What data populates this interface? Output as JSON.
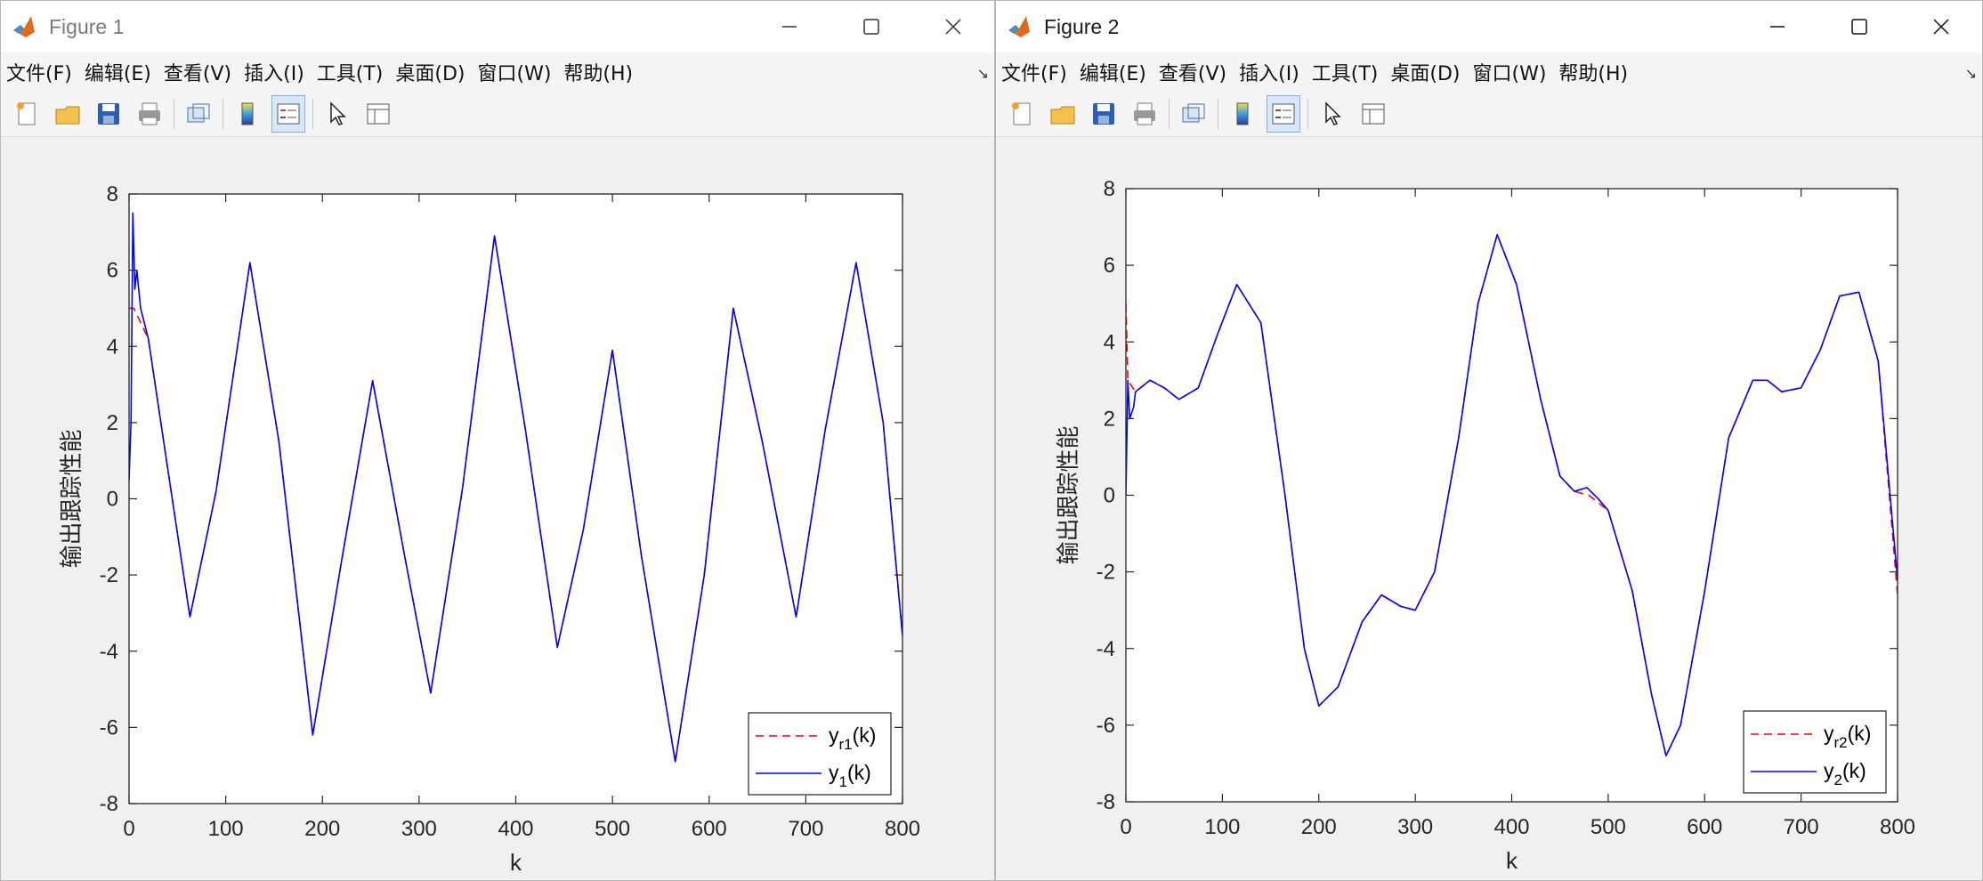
{
  "windows": [
    {
      "title": "Figure 1",
      "menus": [
        "文件(F)",
        "编辑(E)",
        "查看(V)",
        "插入(I)",
        "工具(T)",
        "桌面(D)",
        "窗口(W)",
        "帮助(H)"
      ],
      "toolbar_icons": [
        "new-figure-icon",
        "open-file-icon",
        "save-icon",
        "print-icon",
        "link-icon",
        "colorbar-icon",
        "legend-icon",
        "pointer-icon",
        "property-editor-icon"
      ]
    },
    {
      "title": "Figure 2",
      "menus": [
        "文件(F)",
        "编辑(E)",
        "查看(V)",
        "插入(I)",
        "工具(T)",
        "桌面(D)",
        "窗口(W)",
        "帮助(H)"
      ],
      "toolbar_icons": [
        "new-figure-icon",
        "open-file-icon",
        "save-icon",
        "print-icon",
        "link-icon",
        "colorbar-icon",
        "legend-icon",
        "pointer-icon",
        "property-editor-icon"
      ]
    }
  ],
  "colors": {
    "reference": "#ff0000",
    "output": "#0000ff",
    "axes_bg": "#ffffff",
    "frame_bg": "#f0f0f0"
  },
  "chart_data": [
    {
      "type": "line",
      "xlabel": "k",
      "ylabel": "输出跟踪性能",
      "xlim": [
        0,
        800
      ],
      "ylim": [
        -8,
        8
      ],
      "xticks": [
        "0",
        "100",
        "200",
        "300",
        "400",
        "500",
        "600",
        "700",
        "800"
      ],
      "yticks": [
        "-8",
        "-6",
        "-4",
        "-2",
        "0",
        "2",
        "4",
        "6",
        "8"
      ],
      "legend_position": "bottom-right",
      "grid": false,
      "legend": {
        "ref_sub": "r1",
        "out_sub": "1"
      },
      "series": [
        {
          "name": "y_r1(k)",
          "style": "dashed",
          "color": "#ff0000",
          "x": [
            0,
            5,
            20,
            40,
            63,
            90,
            125,
            155,
            190,
            220,
            252,
            285,
            312,
            345,
            378,
            410,
            443,
            470,
            500,
            530,
            565,
            595,
            625,
            655,
            690,
            720,
            752,
            780,
            800
          ],
          "y": [
            5.0,
            5.0,
            4.2,
            0.8,
            -3.1,
            0.2,
            6.2,
            1.5,
            -6.2,
            -1.6,
            3.1,
            -1.5,
            -5.1,
            0.3,
            6.9,
            1.8,
            -3.9,
            -0.8,
            3.9,
            -1.5,
            -6.9,
            -2.0,
            5.0,
            1.5,
            -3.1,
            1.8,
            6.2,
            2.0,
            -3.6
          ]
        },
        {
          "name": "y_1(k)",
          "style": "solid",
          "color": "#0000ff",
          "x": [
            0,
            2,
            4,
            6,
            8,
            12,
            20,
            40,
            63,
            90,
            125,
            155,
            190,
            220,
            252,
            285,
            312,
            345,
            378,
            410,
            443,
            470,
            500,
            530,
            565,
            595,
            625,
            655,
            690,
            720,
            752,
            780,
            800
          ],
          "y": [
            0.5,
            2.0,
            7.5,
            5.5,
            6.0,
            5.0,
            4.2,
            0.8,
            -3.1,
            0.2,
            6.2,
            1.5,
            -6.2,
            -1.6,
            3.1,
            -1.5,
            -5.1,
            0.3,
            6.9,
            1.8,
            -3.9,
            -0.8,
            3.9,
            -1.5,
            -6.9,
            -2.0,
            5.0,
            1.5,
            -3.1,
            1.8,
            6.2,
            2.0,
            -3.6
          ]
        }
      ]
    },
    {
      "type": "line",
      "xlabel": "k",
      "ylabel": "输出跟踪性能",
      "xlim": [
        0,
        800
      ],
      "ylim": [
        -8,
        8
      ],
      "xticks": [
        "0",
        "100",
        "200",
        "300",
        "400",
        "500",
        "600",
        "700",
        "800"
      ],
      "yticks": [
        "-8",
        "-6",
        "-4",
        "-2",
        "0",
        "2",
        "4",
        "6",
        "8"
      ],
      "legend_position": "bottom-right",
      "grid": false,
      "legend": {
        "ref_sub": "r2",
        "out_sub": "2"
      },
      "series": [
        {
          "name": "y_r2(k)",
          "style": "dashed",
          "color": "#ff0000",
          "x": [
            0,
            2,
            10,
            25,
            40,
            55,
            75,
            95,
            115,
            140,
            165,
            185,
            200,
            220,
            245,
            265,
            285,
            300,
            320,
            345,
            365,
            385,
            405,
            430,
            450,
            465,
            480,
            500,
            525,
            545,
            560,
            575,
            600,
            625,
            650,
            665,
            680,
            700,
            720,
            740,
            760,
            780,
            800
          ],
          "y": [
            5.0,
            3.0,
            2.7,
            3.0,
            2.8,
            2.5,
            2.8,
            4.2,
            5.5,
            4.5,
            0.0,
            -4.0,
            -5.5,
            -5.0,
            -3.3,
            -2.6,
            -2.9,
            -3.0,
            -2.0,
            1.5,
            5.0,
            6.8,
            5.5,
            2.5,
            0.5,
            0.1,
            0.0,
            -0.4,
            -2.5,
            -5.2,
            -6.8,
            -6.0,
            -2.5,
            1.5,
            3.0,
            3.0,
            2.7,
            2.8,
            3.8,
            5.2,
            5.3,
            3.5,
            -2.6
          ]
        },
        {
          "name": "y_2(k)",
          "style": "solid",
          "color": "#0000ff",
          "x": [
            0,
            2,
            4,
            8,
            10,
            25,
            40,
            55,
            75,
            95,
            115,
            140,
            165,
            185,
            200,
            220,
            245,
            265,
            285,
            300,
            320,
            345,
            365,
            385,
            405,
            430,
            450,
            465,
            478,
            490,
            500,
            525,
            545,
            560,
            575,
            600,
            625,
            650,
            665,
            680,
            700,
            720,
            740,
            760,
            780,
            800
          ],
          "y": [
            0.0,
            3.0,
            2.0,
            2.3,
            2.7,
            3.0,
            2.8,
            2.5,
            2.8,
            4.2,
            5.5,
            4.5,
            0.0,
            -4.0,
            -5.5,
            -5.0,
            -3.3,
            -2.6,
            -2.9,
            -3.0,
            -2.0,
            1.5,
            5.0,
            6.8,
            5.5,
            2.5,
            0.5,
            0.1,
            0.2,
            -0.1,
            -0.4,
            -2.5,
            -5.2,
            -6.8,
            -6.0,
            -2.5,
            1.5,
            3.0,
            3.0,
            2.7,
            2.8,
            3.8,
            5.2,
            5.3,
            3.5,
            -2.2
          ]
        }
      ]
    }
  ]
}
